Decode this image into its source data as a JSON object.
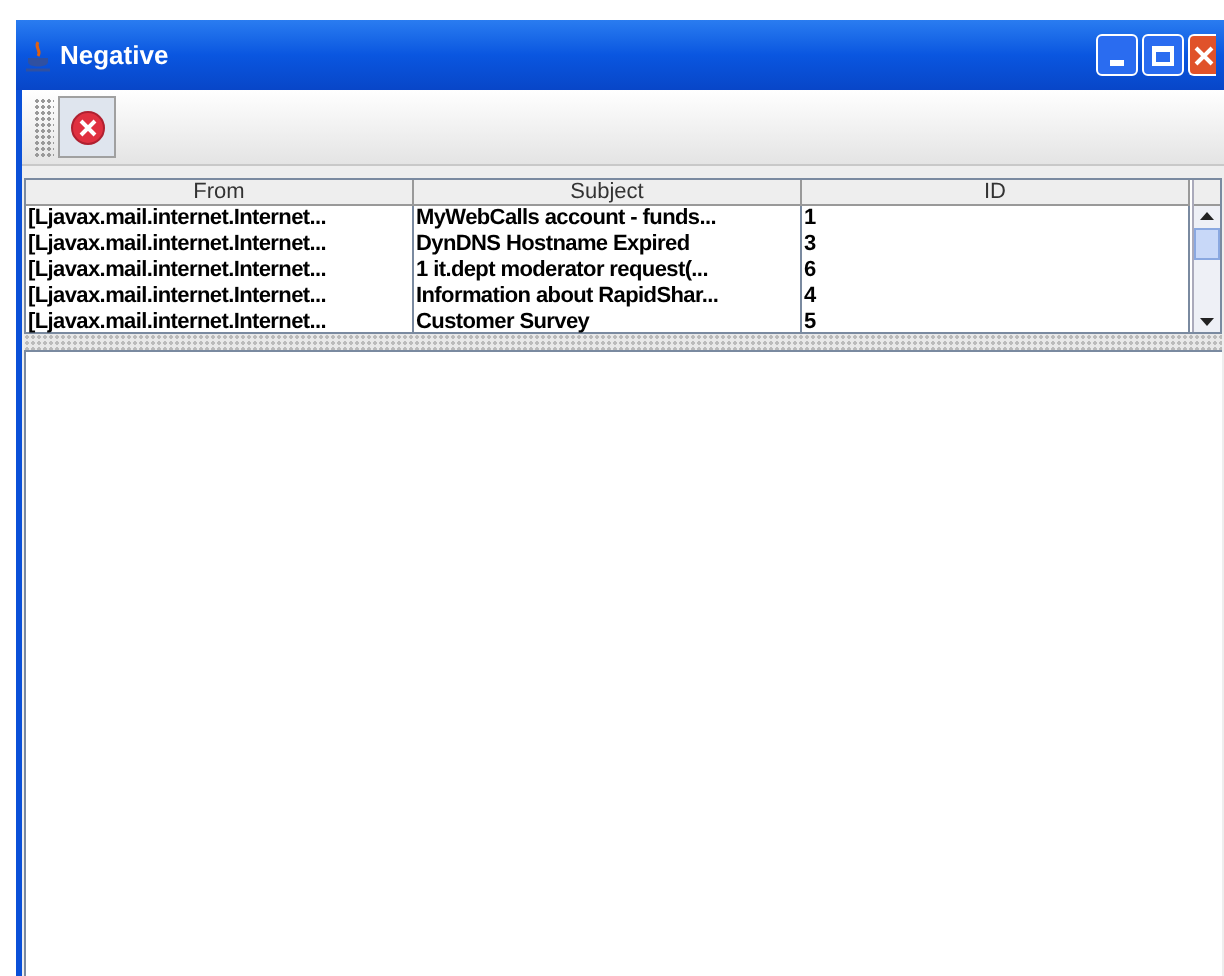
{
  "window": {
    "title": "Negative"
  },
  "table": {
    "columns": [
      "From",
      "Subject",
      "ID"
    ],
    "rows": [
      [
        "[Ljavax.mail.internet.Internet...",
        "MyWebCalls account - funds...",
        "1"
      ],
      [
        "[Ljavax.mail.internet.Internet...",
        "DynDNS Hostname Expired",
        "3"
      ],
      [
        "[Ljavax.mail.internet.Internet...",
        "1 it.dept moderator request(...",
        "6"
      ],
      [
        "[Ljavax.mail.internet.Internet...",
        "Information about RapidShar...",
        "4"
      ],
      [
        "[Ljavax.mail.internet.Internet...",
        "Customer Survey",
        "5"
      ]
    ]
  }
}
